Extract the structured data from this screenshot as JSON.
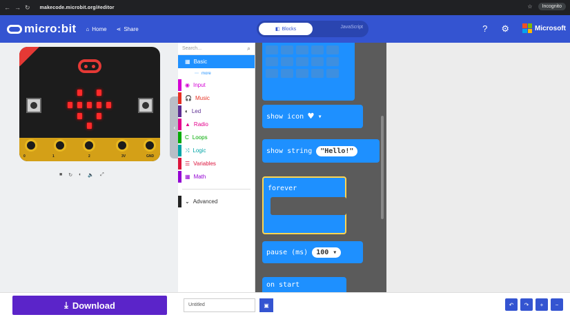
{
  "browser": {
    "url": "makecode.microbit.org/#editor",
    "incognito": "Incognito"
  },
  "header": {
    "logo": "micro:bit",
    "home": "Home",
    "share": "Share",
    "blocks_tab": "Blocks",
    "js_tab": "JavaScript",
    "brand": "Microsoft"
  },
  "simulator": {
    "pin_labels": [
      "0",
      "1",
      "2",
      "3V",
      "GND"
    ],
    "controls": [
      "■",
      "↻",
      "◐",
      "🔈",
      "⤢"
    ]
  },
  "toolbox": {
    "search_placeholder": "Search...",
    "categories": [
      {
        "label": "Basic",
        "icon": "▦",
        "color": "#1e90ff"
      },
      {
        "label": "Input",
        "icon": "◉",
        "color": "#d400d4"
      },
      {
        "label": "Music",
        "icon": "🎧",
        "color": "#e63022"
      },
      {
        "label": "Led",
        "icon": "◐",
        "color": "#5c2d91"
      },
      {
        "label": "Radio",
        "icon": "▲",
        "color": "#e3008c"
      },
      {
        "label": "Loops",
        "icon": "C",
        "color": "#00aa00"
      },
      {
        "label": "Logic",
        "icon": "⤨",
        "color": "#00a4a6"
      },
      {
        "label": "Variables",
        "icon": "☰",
        "color": "#dc143c"
      },
      {
        "label": "Math",
        "icon": "▦",
        "color": "#9400d3"
      }
    ],
    "basic_more": "more",
    "advanced": "Advanced"
  },
  "flyout": {
    "show_icon": "show icon",
    "show_string": "show string",
    "string_value": "\"Hello!\"",
    "forever": "forever",
    "pause": "pause (ms)",
    "pause_value": "100",
    "on_start": "on start"
  },
  "bottom": {
    "download": "Download",
    "project_name": "Untitled"
  },
  "colors": {
    "header": "#3454d1",
    "download": "#5b24c9",
    "blocks": "#1e90ff"
  }
}
